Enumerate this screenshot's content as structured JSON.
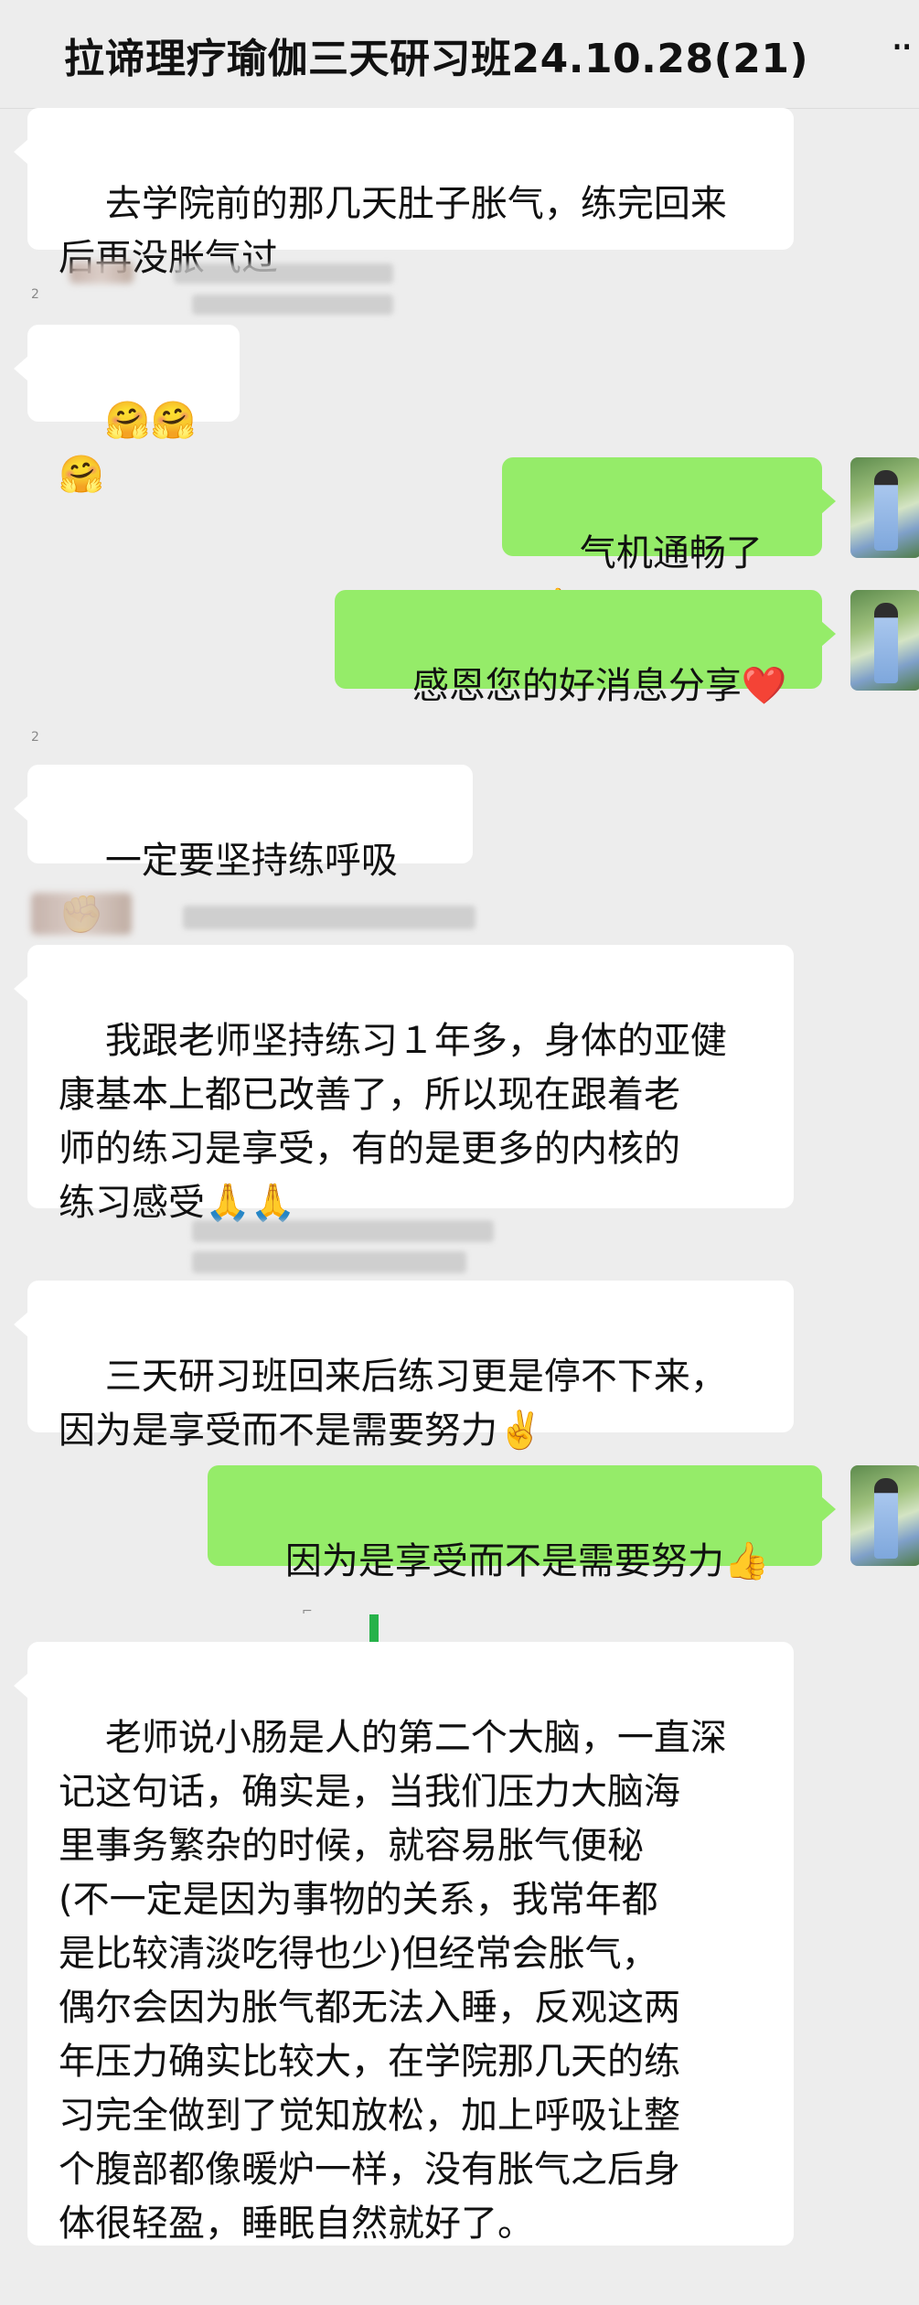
{
  "header": {
    "title": "拉谛理疗瑜伽三天研习班24.10.28(21)",
    "more_icon": "more-icon",
    "more_glyph": "··"
  },
  "messages": [
    {
      "dir": "in",
      "text": "去学院前的那几天肚子胀气，练完回来\n后再没胀气过"
    },
    {
      "dir": "in",
      "text": "🤗🤗🤗"
    },
    {
      "dir": "out",
      "text": "气机通畅了👍"
    },
    {
      "dir": "out",
      "text": "感恩您的好消息分享❤️"
    },
    {
      "dir": "in",
      "text": "一定要坚持练呼吸✊"
    },
    {
      "dir": "in",
      "text": "我跟老师坚持练习１年多，身体的亚健\n康基本上都已改善了，所以现在跟着老\n师的练习是享受，有的是更多的内核的\n练习感受🙏🙏"
    },
    {
      "dir": "in",
      "text": "三天研习班回来后练习更是停不下来，\n因为是享受而不是需要努力✌️"
    },
    {
      "dir": "out",
      "text": "因为是享受而不是需要努力👍"
    },
    {
      "dir": "in",
      "text": "老师说小肠是人的第二个大脑，一直深\n记这句话，确实是，当我们压力大脑海\n里事务繁杂的时候，就容易胀气便秘\n(不一定是因为事物的关系，我常年都\n是比较清淡吃得也少)但经常会胀气，\n偶尔会因为胀气都无法入睡，反观这两\n年压力确实比较大，在学院那几天的练\n习完全做到了觉知放松，加上呼吸让整\n个腹部都像暖炉一样，没有胀气之后身\n体很轻盈，睡眠自然就好了。"
    }
  ]
}
